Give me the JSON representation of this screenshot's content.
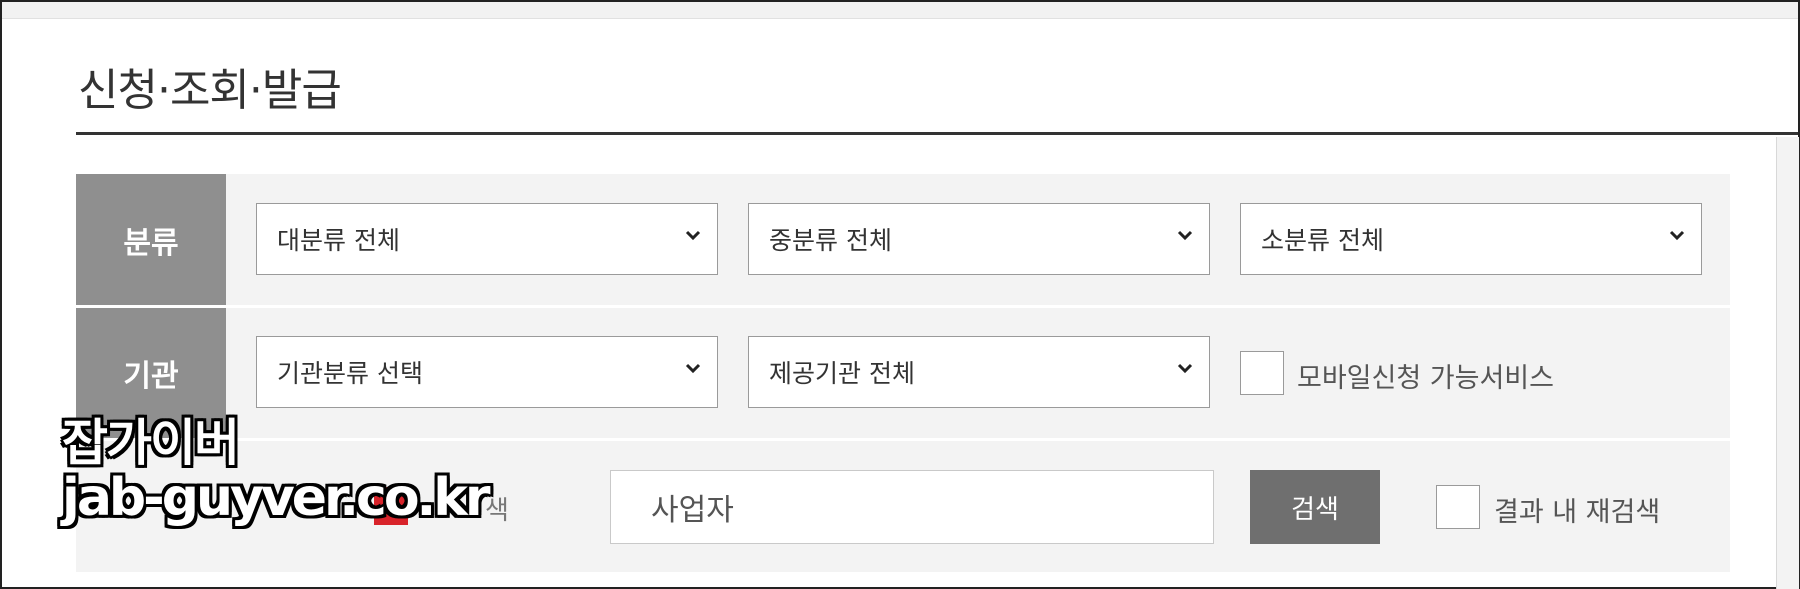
{
  "page": {
    "title": "신청·조회·발급"
  },
  "filters": {
    "category": {
      "label": "분류",
      "major": "대분류 전체",
      "middle": "중분류 전체",
      "minor": "소분류 전체"
    },
    "agency": {
      "label": "기관",
      "type": "기관분류 선택",
      "provider": "제공기관 전체",
      "mobile_checkbox_label": "모바일신청 가능서비스"
    },
    "search": {
      "partial_label": "색",
      "value": "사업자",
      "button_label": "검색",
      "refine_checkbox_label": "결과 내 재검색"
    }
  },
  "colors": {
    "label_bg": "#8f8f8f",
    "panel_bg": "#f3f3f3",
    "button_bg": "#6f6f6f",
    "accent_red": "#d8232a"
  },
  "watermark": {
    "line1": "잡가이버",
    "line2": "jab-guyver.co.kr"
  }
}
